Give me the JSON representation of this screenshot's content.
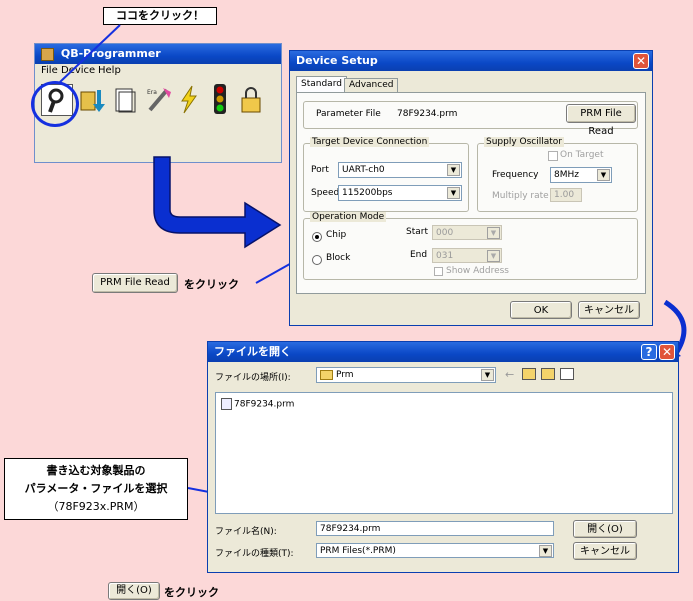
{
  "callouts": {
    "top": "ココをクリック！",
    "prm_button": "PRM File Read",
    "prm_click": "をクリック",
    "select_line1": "書き込む対象製品の",
    "select_line2": "パラメータ・ファイルを選択",
    "select_line3": "（78F923x.PRM）",
    "open_button": "開く(O)",
    "open_click": "をクリック"
  },
  "qb_window": {
    "title": "QB-Programmer",
    "menu": [
      "File",
      "Device",
      "Help"
    ]
  },
  "device_setup": {
    "title": "Device Setup",
    "tabs": [
      "Standard",
      "Advanced"
    ],
    "parameter_file_label": "Parameter File",
    "parameter_file_value": "78F9234.prm",
    "prm_button": "PRM File Read",
    "target_group": "Target Device Connection",
    "port_label": "Port",
    "port_value": "UART-ch0",
    "speed_label": "Speed",
    "speed_value": "115200bps",
    "supply_group": "Supply Oscillator",
    "on_target": "On Target",
    "frequency_label": "Frequency",
    "frequency_value": "8MHz",
    "multiply_label": "Multiply rate",
    "multiply_value": "1.00",
    "opmode_group": "Operation Mode",
    "chip": "Chip",
    "block": "Block",
    "start_label": "Start",
    "start_value": "000",
    "end_label": "End",
    "end_value": "031",
    "show_address": "Show Address",
    "ok": "OK",
    "cancel": "キャンセル"
  },
  "file_dialog": {
    "title": "ファイルを開く",
    "look_in_label": "ファイルの場所(I):",
    "look_in_value": "Prm",
    "files": [
      "78F9234.prm"
    ],
    "filename_label": "ファイル名(N):",
    "filename_value": "78F9234.prm",
    "filetype_label": "ファイルの種類(T):",
    "filetype_value": "PRM Files(*.PRM)",
    "open": "開く(O)",
    "cancel": "キャンセル"
  },
  "colors": {
    "background": "#fcd8d8",
    "titlebar": "#0a48c6",
    "arrow": "#0a2fd0",
    "close": "#e0553a"
  }
}
